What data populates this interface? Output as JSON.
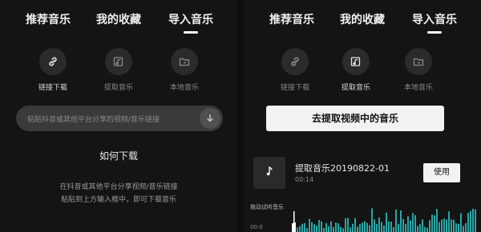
{
  "left": {
    "tabs": [
      "推荐音乐",
      "我的收藏",
      "导入音乐"
    ],
    "options": [
      {
        "label": "链接下载",
        "icon": "link-icon",
        "active": true
      },
      {
        "label": "提取音乐",
        "icon": "video-music-icon",
        "active": false
      },
      {
        "label": "本地音乐",
        "icon": "folder-icon",
        "active": false
      }
    ],
    "url_placeholder": "粘贴抖音或其他平台分享的视频/音乐链接",
    "howto_title": "如何下载",
    "tips": [
      "在抖音或其他平台分享视频/音乐链接",
      "粘贴到上方输入框中，即可下载音乐"
    ]
  },
  "right": {
    "tabs": [
      "推荐音乐",
      "我的收藏",
      "导入音乐"
    ],
    "options": [
      {
        "label": "链接下载",
        "icon": "link-icon",
        "active": false
      },
      {
        "label": "提取音乐",
        "icon": "video-music-icon",
        "active": true
      },
      {
        "label": "本地音乐",
        "icon": "folder-icon",
        "active": false
      }
    ],
    "extract_label": "去提取视频中的音乐",
    "music": {
      "name": "提取音乐20190822-01",
      "duration": "00:14",
      "use_label": "使用"
    },
    "audition_label": "拖动试听音乐",
    "time_label": "00:0"
  },
  "colors": {
    "wave_played": "#ffffff",
    "wave_rest": "#2aa6a6"
  }
}
